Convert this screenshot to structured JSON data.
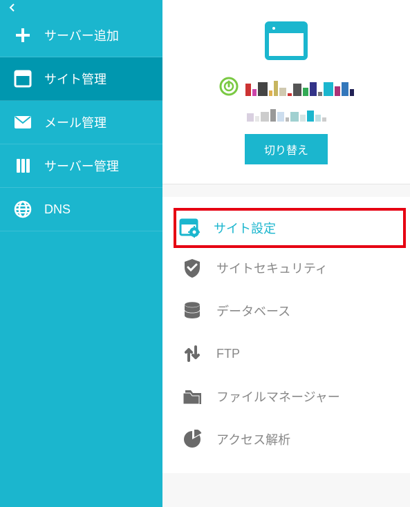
{
  "colors": {
    "primary": "#1bb6ce",
    "primary_dark": "#0097af",
    "highlight_border": "#e60012",
    "status_green": "#7ac943",
    "text_gray": "#888888"
  },
  "sidebar": {
    "items": [
      {
        "label": "サーバー追加",
        "icon": "plus-icon",
        "active": false
      },
      {
        "label": "サイト管理",
        "icon": "window-icon",
        "active": true
      },
      {
        "label": "メール管理",
        "icon": "mail-icon",
        "active": false
      },
      {
        "label": "サーバー管理",
        "icon": "server-icon",
        "active": false
      },
      {
        "label": "DNS",
        "icon": "globe-icon",
        "active": false
      }
    ]
  },
  "header": {
    "switch_button": "切り替え",
    "domain_text": "[サイト名（ぼかし）]",
    "sub_text": "[サーバー名（ぼかし）]"
  },
  "menu": {
    "items": [
      {
        "label": "サイト設定",
        "icon": "site-settings-icon",
        "highlighted": true
      },
      {
        "label": "サイトセキュリティ",
        "icon": "shield-check-icon",
        "highlighted": false
      },
      {
        "label": "データベース",
        "icon": "database-icon",
        "highlighted": false
      },
      {
        "label": "FTP",
        "icon": "ftp-arrows-icon",
        "highlighted": false
      },
      {
        "label": "ファイルマネージャー",
        "icon": "folder-icon",
        "highlighted": false
      },
      {
        "label": "アクセス解析",
        "icon": "pie-chart-icon",
        "highlighted": false
      }
    ]
  }
}
